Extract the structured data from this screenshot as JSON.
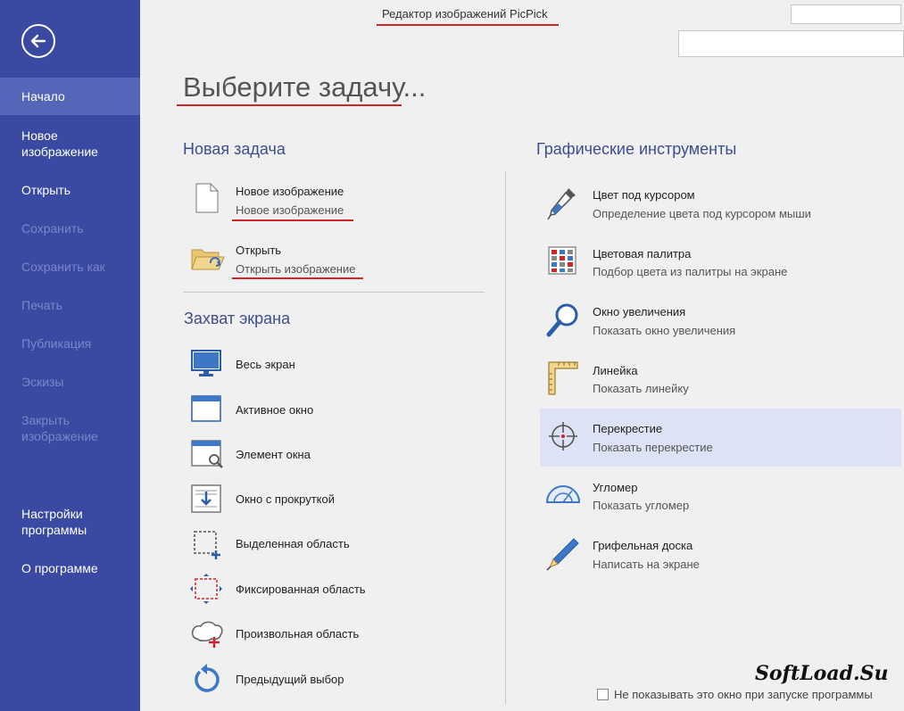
{
  "app": {
    "title": "Редактор изображений PicPick"
  },
  "sidebar": {
    "items": [
      {
        "label": "Начало",
        "state": "active"
      },
      {
        "label": "Новое изображение",
        "state": "enabled"
      },
      {
        "label": "Открыть",
        "state": "enabled"
      },
      {
        "label": "Сохранить",
        "state": "disabled"
      },
      {
        "label": "Сохранить как",
        "state": "disabled"
      },
      {
        "label": "Печать",
        "state": "disabled"
      },
      {
        "label": "Публикация",
        "state": "disabled"
      },
      {
        "label": "Эскизы",
        "state": "disabled"
      },
      {
        "label": "Закрыть изображение",
        "state": "disabled"
      },
      {
        "label": "Настройки программы",
        "state": "enabled"
      },
      {
        "label": "О программе",
        "state": "enabled"
      }
    ]
  },
  "main": {
    "title": "Выберите задачу...",
    "new_task": {
      "title": "Новая задача",
      "items": [
        {
          "name": "Новое изображение",
          "desc": "Новое изображение",
          "icon": "blank-page-icon"
        },
        {
          "name": "Открыть",
          "desc": "Открыть изображение",
          "icon": "open-folder-icon"
        }
      ]
    },
    "capture": {
      "title": "Захват экрана",
      "items": [
        {
          "label": "Весь экран",
          "icon": "full-screen-icon"
        },
        {
          "label": "Активное окно",
          "icon": "active-window-icon"
        },
        {
          "label": "Элемент окна",
          "icon": "window-element-icon"
        },
        {
          "label": "Окно с прокруткой",
          "icon": "scrolling-window-icon"
        },
        {
          "label": "Выделенная область",
          "icon": "region-icon"
        },
        {
          "label": "Фиксированная область",
          "icon": "fixed-region-icon"
        },
        {
          "label": "Произвольная область",
          "icon": "freehand-region-icon"
        },
        {
          "label": "Предыдущий выбор",
          "icon": "repeat-last-icon"
        }
      ]
    },
    "tools": {
      "title": "Графические инструменты",
      "items": [
        {
          "name": "Цвет под курсором",
          "desc": "Определение цвета под курсором мыши",
          "icon": "eyedropper-icon"
        },
        {
          "name": "Цветовая палитра",
          "desc": "Подбор цвета из палитры на экране",
          "icon": "color-palette-icon"
        },
        {
          "name": "Окно увеличения",
          "desc": "Показать окно увеличения",
          "icon": "magnifier-icon"
        },
        {
          "name": "Линейка",
          "desc": "Показать линейку",
          "icon": "ruler-icon"
        },
        {
          "name": "Перекрестие",
          "desc": "Показать перекрестие",
          "icon": "crosshair-icon",
          "state": "hover"
        },
        {
          "name": "Угломер",
          "desc": "Показать угломер",
          "icon": "protractor-icon"
        },
        {
          "name": "Грифельная доска",
          "desc": "Написать на экране",
          "icon": "whiteboard-pen-icon"
        }
      ]
    },
    "footer": {
      "dont_show_label": "Не показывать это окно при запуске программы",
      "checked": false
    }
  },
  "watermark": "SoftLoad.Su",
  "colors": {
    "sidebar_bg": "#3a4aa2",
    "sidebar_active": "#5566b8",
    "annotation_red": "#d0232a",
    "hover_bg": "#dde3f5",
    "section_title": "#3d4e8e"
  }
}
